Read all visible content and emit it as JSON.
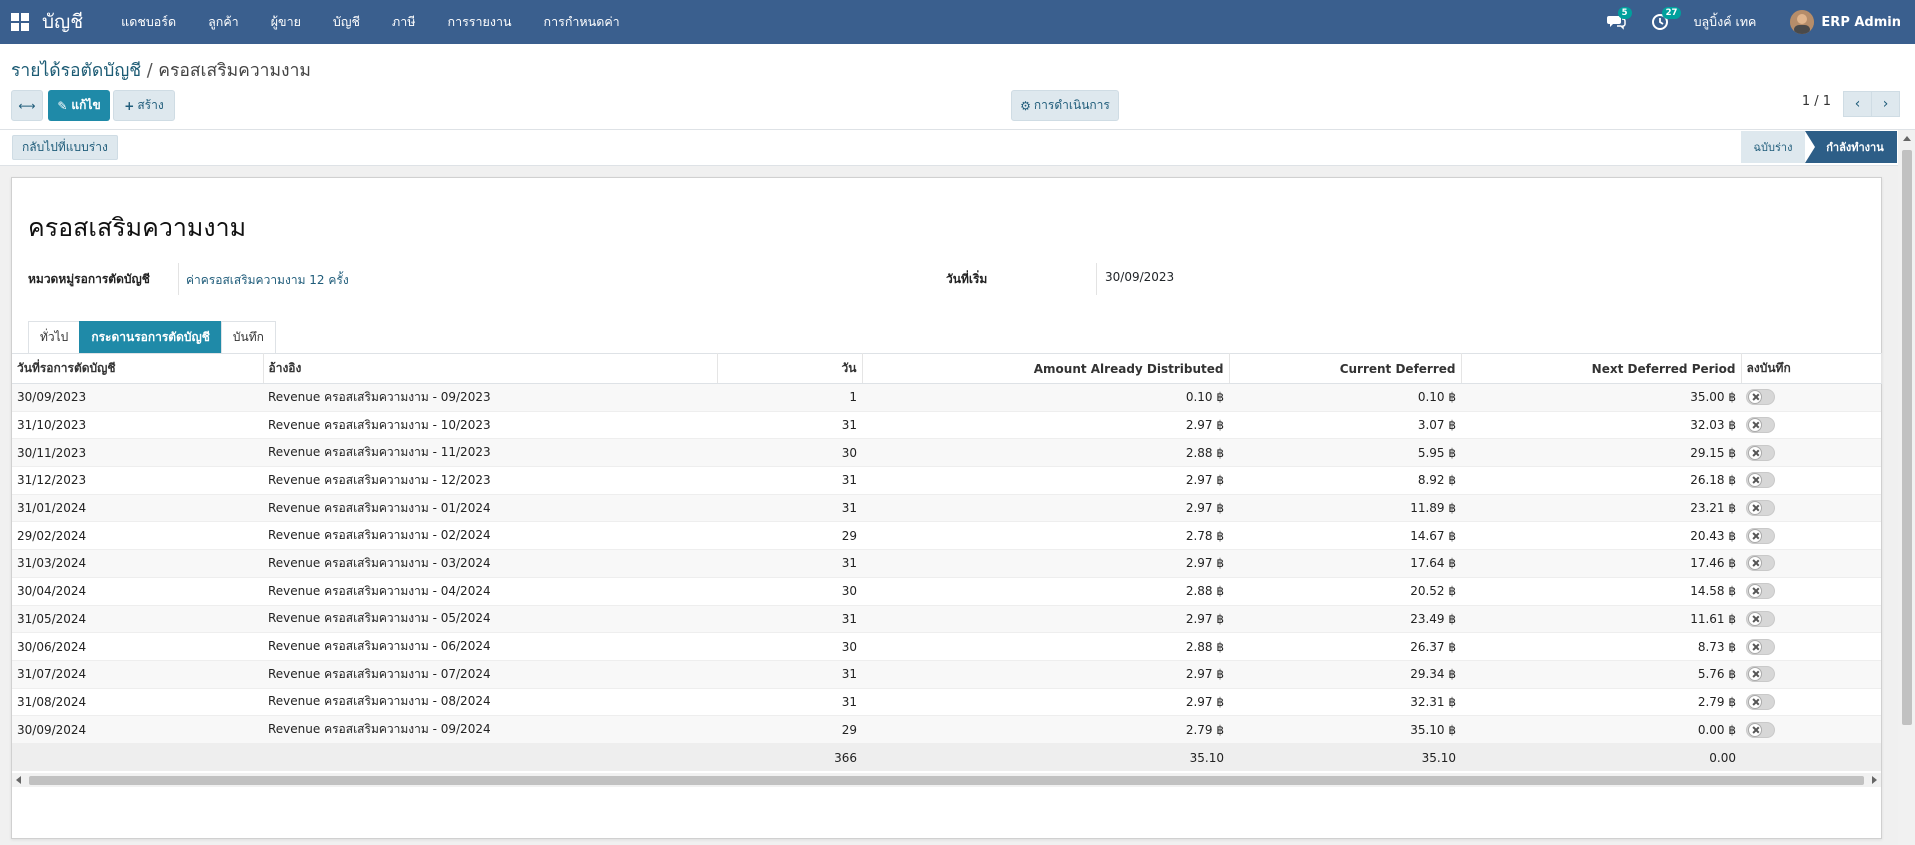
{
  "navbar": {
    "brand": "บัญชี",
    "menu": [
      "แดชบอร์ด",
      "ลูกค้า",
      "ผู้ขาย",
      "บัญชี",
      "ภาษี",
      "การรายงาน",
      "การกำหนดค่า"
    ],
    "messages_count": "5",
    "activities_count": "27",
    "company": "บลูบิ้งค์ เทค",
    "user": "ERP Admin"
  },
  "breadcrumb": {
    "parent": "รายได้รอตัดบัญชี",
    "separator": "/",
    "current": "ครอสเสริมความงาม"
  },
  "toolbar": {
    "edit_label": "แก้ไข",
    "create_label": "สร้าง",
    "action_label": "การดำเนินการ"
  },
  "pager": {
    "value": "1 / 1"
  },
  "statusbar": {
    "back_to_draft": "กลับไปที่แบบร่าง",
    "stages": [
      "ฉบับร่าง",
      "กำลังทำงาน"
    ],
    "active_stage": "กำลังทำงาน"
  },
  "record": {
    "name": "ครอสเสริมความงาม",
    "category_label": "หมวดหมู่รอการตัดบัญชี",
    "category_value": "ค่าครอสเสริมความงาม 12 ครั้ง",
    "start_date_label": "วันที่เริ่ม",
    "start_date_value": "30/09/2023"
  },
  "tabs": [
    "ทั่วไป",
    "กระดานรอการตัดบัญชี",
    "บันทึก"
  ],
  "active_tab": "กระดานรอการตัดบัญชี",
  "table": {
    "columns": [
      "วันที่รอการตัดบัญชี",
      "อ้างอิง",
      "วัน",
      "Amount Already Distributed",
      "Current Deferred",
      "Next Deferred Period",
      "ลงบันทึก"
    ],
    "rows": [
      [
        "30/09/2023",
        "Revenue ครอสเสริมความงาม - 09/2023",
        "1",
        "0.10 ฿",
        "0.10 ฿",
        "35.00 ฿"
      ],
      [
        "31/10/2023",
        "Revenue ครอสเสริมความงาม - 10/2023",
        "31",
        "2.97 ฿",
        "3.07 ฿",
        "32.03 ฿"
      ],
      [
        "30/11/2023",
        "Revenue ครอสเสริมความงาม - 11/2023",
        "30",
        "2.88 ฿",
        "5.95 ฿",
        "29.15 ฿"
      ],
      [
        "31/12/2023",
        "Revenue ครอสเสริมความงาม - 12/2023",
        "31",
        "2.97 ฿",
        "8.92 ฿",
        "26.18 ฿"
      ],
      [
        "31/01/2024",
        "Revenue ครอสเสริมความงาม - 01/2024",
        "31",
        "2.97 ฿",
        "11.89 ฿",
        "23.21 ฿"
      ],
      [
        "29/02/2024",
        "Revenue ครอสเสริมความงาม - 02/2024",
        "29",
        "2.78 ฿",
        "14.67 ฿",
        "20.43 ฿"
      ],
      [
        "31/03/2024",
        "Revenue ครอสเสริมความงาม - 03/2024",
        "31",
        "2.97 ฿",
        "17.64 ฿",
        "17.46 ฿"
      ],
      [
        "30/04/2024",
        "Revenue ครอสเสริมความงาม - 04/2024",
        "30",
        "2.88 ฿",
        "20.52 ฿",
        "14.58 ฿"
      ],
      [
        "31/05/2024",
        "Revenue ครอสเสริมความงาม - 05/2024",
        "31",
        "2.97 ฿",
        "23.49 ฿",
        "11.61 ฿"
      ],
      [
        "30/06/2024",
        "Revenue ครอสเสริมความงาม - 06/2024",
        "30",
        "2.88 ฿",
        "26.37 ฿",
        "8.73 ฿"
      ],
      [
        "31/07/2024",
        "Revenue ครอสเสริมความงาม - 07/2024",
        "31",
        "2.97 ฿",
        "29.34 ฿",
        "5.76 ฿"
      ],
      [
        "31/08/2024",
        "Revenue ครอสเสริมความงาม - 08/2024",
        "31",
        "2.97 ฿",
        "32.31 ฿",
        "2.79 ฿"
      ],
      [
        "30/09/2024",
        "Revenue ครอสเสริมความงาม - 09/2024",
        "29",
        "2.79 ฿",
        "35.10 ฿",
        "0.00 ฿"
      ]
    ],
    "totals": [
      "",
      "",
      "366",
      "35.10",
      "35.10",
      "0.00",
      ""
    ]
  },
  "colors": {
    "navbar": "#3a5f8e",
    "primary": "#1f8aa8",
    "stage_active": "#2d5e87",
    "link": "#1f5c7a"
  }
}
